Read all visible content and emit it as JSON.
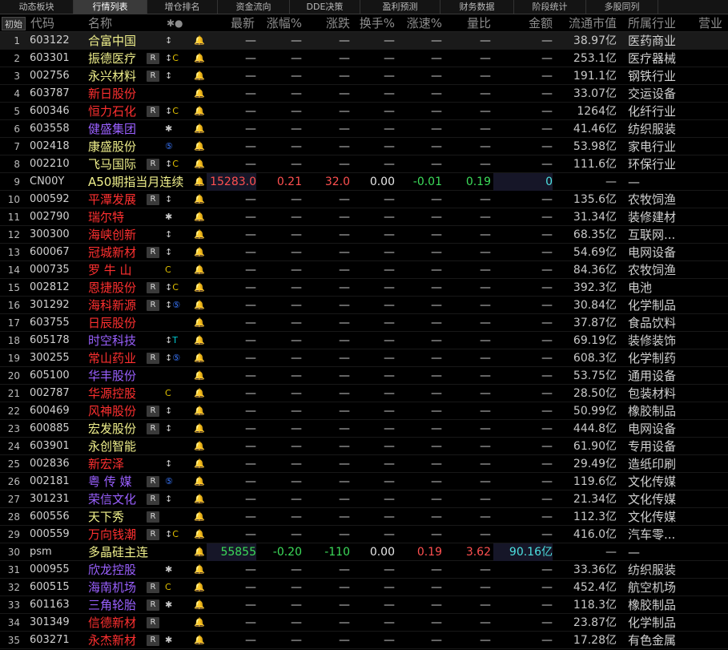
{
  "tabs": [
    {
      "label": "动态板块",
      "active": false
    },
    {
      "label": "行情列表",
      "active": true
    },
    {
      "label": "增仓排名",
      "active": false
    },
    {
      "label": "资金流向",
      "active": false
    },
    {
      "label": "DDE决策",
      "active": false
    },
    {
      "label": "盈利预测",
      "active": false
    },
    {
      "label": "财务数据",
      "active": false
    },
    {
      "label": "阶段统计",
      "active": false
    },
    {
      "label": "多股同列",
      "active": false
    }
  ],
  "header": {
    "reset": "初始",
    "code": "代码",
    "name": "名称",
    "mark": "✱●",
    "latest": "最新",
    "change_pct": "涨幅%",
    "change_amt": "涨跌",
    "turnover": "换手%",
    "speed": "涨速%",
    "volume_ratio": "量比",
    "amount": "金额",
    "float_cap": "流通市值",
    "industry": "所属行业",
    "business": "营业"
  },
  "colors": {
    "red": "#ff3030",
    "yellow": "#f0f08c",
    "purple": "#9a60ff",
    "up": "#ff5050",
    "down": "#3cdc5a"
  },
  "rows": [
    {
      "idx": "1",
      "code": "603122",
      "name": "合富中国",
      "nc": "y",
      "flag": "",
      "mark": [
        [
          "↕",
          ""
        ],
        [
          "",
          ""
        ]
      ],
      "cap": "38.97亿",
      "ind": "医药商业"
    },
    {
      "idx": "2",
      "code": "603301",
      "name": "振德医疗",
      "nc": "y",
      "flag": "R",
      "mark": [
        [
          "↕",
          ""
        ],
        [
          "C",
          "cc"
        ]
      ],
      "cap": "253.1亿",
      "ind": "医疗器械"
    },
    {
      "idx": "3",
      "code": "002756",
      "name": "永兴材料",
      "nc": "y",
      "flag": "R",
      "mark": [
        [
          "↕",
          ""
        ],
        [
          "",
          ""
        ]
      ],
      "cap": "191.1亿",
      "ind": "钢铁行业"
    },
    {
      "idx": "4",
      "code": "603787",
      "name": "新日股份",
      "nc": "r",
      "flag": "",
      "mark": [
        [
          "",
          ""
        ],
        [
          "",
          ""
        ]
      ],
      "cap": "33.07亿",
      "ind": "交运设备"
    },
    {
      "idx": "5",
      "code": "600346",
      "name": "恒力石化",
      "nc": "r",
      "flag": "R",
      "mark": [
        [
          "↕",
          ""
        ],
        [
          "C",
          "cc"
        ]
      ],
      "cap": "1264亿",
      "ind": "化纤行业"
    },
    {
      "idx": "6",
      "code": "603558",
      "name": "健盛集团",
      "nc": "p",
      "flag": "",
      "mark": [
        [
          "✱",
          ""
        ],
        [
          "",
          ""
        ]
      ],
      "cap": "41.46亿",
      "ind": "纺织服装"
    },
    {
      "idx": "7",
      "code": "002418",
      "name": "康盛股份",
      "nc": "y",
      "flag": "",
      "mark": [
        [
          "",
          ""
        ],
        [
          "⑤",
          "cir"
        ]
      ],
      "cap": "53.98亿",
      "ind": "家电行业"
    },
    {
      "idx": "8",
      "code": "002210",
      "name": "飞马国际",
      "nc": "y",
      "flag": "R",
      "mark": [
        [
          "↕",
          ""
        ],
        [
          "C",
          "cc"
        ]
      ],
      "cap": "111.6亿",
      "ind": "环保行业"
    },
    {
      "idx": "9",
      "code": "CN00Y",
      "name": "A50期指当月连续",
      "nc": "y",
      "flag": "",
      "mark": [
        [
          "",
          ""
        ],
        [
          "",
          ""
        ]
      ],
      "special": {
        "new": "15283.0",
        "chg": "0.21",
        "amt": "32.0",
        "turn": "0.00",
        "spd": "-0.01",
        "vr": "0.19",
        "money": "0"
      },
      "cap": "—",
      "ind": "—"
    },
    {
      "idx": "10",
      "code": "000592",
      "name": "平潭发展",
      "nc": "r",
      "flag": "R",
      "mark": [
        [
          "↕",
          ""
        ],
        [
          "",
          ""
        ]
      ],
      "cap": "135.6亿",
      "ind": "农牧饲渔"
    },
    {
      "idx": "11",
      "code": "002790",
      "name": "瑞尔特",
      "nc": "r",
      "flag": "",
      "mark": [
        [
          "✱",
          ""
        ],
        [
          "",
          ""
        ]
      ],
      "cap": "31.34亿",
      "ind": "装修建材"
    },
    {
      "idx": "12",
      "code": "300300",
      "name": "海峡创新",
      "nc": "r",
      "flag": "",
      "mark": [
        [
          "↕",
          ""
        ],
        [
          "",
          ""
        ]
      ],
      "cap": "68.35亿",
      "ind": "互联网..."
    },
    {
      "idx": "13",
      "code": "600067",
      "name": "冠城新材",
      "nc": "r",
      "flag": "R",
      "mark": [
        [
          "↕",
          ""
        ],
        [
          "",
          ""
        ]
      ],
      "cap": "54.69亿",
      "ind": "电网设备"
    },
    {
      "idx": "14",
      "code": "000735",
      "name": "罗 牛 山",
      "nc": "r",
      "flag": "",
      "mark": [
        [
          "",
          ""
        ],
        [
          "C",
          "cc"
        ]
      ],
      "cap": "84.36亿",
      "ind": "农牧饲渔"
    },
    {
      "idx": "15",
      "code": "002812",
      "name": "恩捷股份",
      "nc": "r",
      "flag": "R",
      "mark": [
        [
          "↕",
          ""
        ],
        [
          "C",
          "cc"
        ]
      ],
      "cap": "392.3亿",
      "ind": "电池"
    },
    {
      "idx": "16",
      "code": "301292",
      "name": "海科新源",
      "nc": "r",
      "flag": "R",
      "mark": [
        [
          "↕",
          ""
        ],
        [
          "⑤",
          "cir"
        ]
      ],
      "cap": "30.84亿",
      "ind": "化学制品"
    },
    {
      "idx": "17",
      "code": "603755",
      "name": "日辰股份",
      "nc": "r",
      "flag": "",
      "mark": [
        [
          "",
          ""
        ],
        [
          "",
          ""
        ]
      ],
      "cap": "37.87亿",
      "ind": "食品饮料"
    },
    {
      "idx": "18",
      "code": "605178",
      "name": "时空科技",
      "nc": "p",
      "flag": "",
      "mark": [
        [
          "↕",
          ""
        ],
        [
          "T",
          "tt"
        ]
      ],
      "cap": "69.19亿",
      "ind": "装修装饰"
    },
    {
      "idx": "19",
      "code": "300255",
      "name": "常山药业",
      "nc": "r",
      "flag": "R",
      "mark": [
        [
          "↕",
          ""
        ],
        [
          "⑤",
          "cir"
        ]
      ],
      "cap": "608.3亿",
      "ind": "化学制药"
    },
    {
      "idx": "20",
      "code": "605100",
      "name": "华丰股份",
      "nc": "p",
      "flag": "",
      "mark": [
        [
          "",
          ""
        ],
        [
          "",
          ""
        ]
      ],
      "cap": "53.75亿",
      "ind": "通用设备"
    },
    {
      "idx": "21",
      "code": "002787",
      "name": "华源控股",
      "nc": "r",
      "flag": "",
      "mark": [
        [
          "",
          ""
        ],
        [
          "C",
          "cc"
        ]
      ],
      "cap": "28.50亿",
      "ind": "包装材料"
    },
    {
      "idx": "22",
      "code": "600469",
      "name": "风神股份",
      "nc": "r",
      "flag": "R",
      "mark": [
        [
          "↕",
          ""
        ],
        [
          "",
          ""
        ]
      ],
      "cap": "50.99亿",
      "ind": "橡胶制品"
    },
    {
      "idx": "23",
      "code": "600885",
      "name": "宏发股份",
      "nc": "y",
      "flag": "R",
      "mark": [
        [
          "↕",
          ""
        ],
        [
          "",
          ""
        ]
      ],
      "cap": "444.8亿",
      "ind": "电网设备"
    },
    {
      "idx": "24",
      "code": "603901",
      "name": "永创智能",
      "nc": "y",
      "flag": "",
      "mark": [
        [
          "",
          ""
        ],
        [
          "",
          ""
        ]
      ],
      "cap": "61.90亿",
      "ind": "专用设备"
    },
    {
      "idx": "25",
      "code": "002836",
      "name": "新宏泽",
      "nc": "r",
      "flag": "",
      "mark": [
        [
          "↕",
          ""
        ],
        [
          "",
          ""
        ]
      ],
      "cap": "29.49亿",
      "ind": "造纸印刷"
    },
    {
      "idx": "26",
      "code": "002181",
      "name": "粤 传 媒",
      "nc": "p",
      "flag": "R",
      "mark": [
        [
          "",
          ""
        ],
        [
          "⑤",
          "cir"
        ]
      ],
      "cap": "119.6亿",
      "ind": "文化传媒"
    },
    {
      "idx": "27",
      "code": "301231",
      "name": "荣信文化",
      "nc": "p",
      "flag": "R",
      "mark": [
        [
          "↕",
          ""
        ],
        [
          "",
          ""
        ]
      ],
      "cap": "21.34亿",
      "ind": "文化传媒"
    },
    {
      "idx": "28",
      "code": "600556",
      "name": "天下秀",
      "nc": "y",
      "flag": "R",
      "mark": [
        [
          "",
          ""
        ],
        [
          "",
          ""
        ]
      ],
      "cap": "112.3亿",
      "ind": "文化传媒"
    },
    {
      "idx": "29",
      "code": "000559",
      "name": "万向钱潮",
      "nc": "r",
      "flag": "R",
      "mark": [
        [
          "↕",
          ""
        ],
        [
          "C",
          "cc"
        ]
      ],
      "cap": "416.0亿",
      "ind": "汽车零..."
    },
    {
      "idx": "30",
      "code": "psm",
      "name": "多晶硅主连",
      "nc": "y",
      "flag": "",
      "mark": [
        [
          "",
          ""
        ],
        [
          "",
          ""
        ]
      ],
      "special": {
        "new": "55855",
        "chg": "-0.20",
        "amt": "-110",
        "turn": "0.00",
        "spd": "0.19",
        "vr": "3.62",
        "money": "90.16亿"
      },
      "cap": "—",
      "ind": "—"
    },
    {
      "idx": "31",
      "code": "000955",
      "name": "欣龙控股",
      "nc": "p",
      "flag": "",
      "mark": [
        [
          "✱",
          ""
        ],
        [
          "",
          ""
        ]
      ],
      "cap": "33.36亿",
      "ind": "纺织服装"
    },
    {
      "idx": "32",
      "code": "600515",
      "name": "海南机场",
      "nc": "p",
      "flag": "R",
      "mark": [
        [
          "",
          ""
        ],
        [
          "C",
          "cc"
        ]
      ],
      "cap": "452.4亿",
      "ind": "航空机场"
    },
    {
      "idx": "33",
      "code": "601163",
      "name": "三角轮胎",
      "nc": "p",
      "flag": "R",
      "mark": [
        [
          "✱",
          ""
        ],
        [
          "",
          ""
        ]
      ],
      "cap": "118.3亿",
      "ind": "橡胶制品"
    },
    {
      "idx": "34",
      "code": "301349",
      "name": "信德新材",
      "nc": "r",
      "flag": "R",
      "mark": [
        [
          "",
          ""
        ],
        [
          "",
          ""
        ]
      ],
      "cap": "23.87亿",
      "ind": "化学制品"
    },
    {
      "idx": "35",
      "code": "603271",
      "name": "永杰新材",
      "nc": "r",
      "flag": "R",
      "mark": [
        [
          "✱",
          ""
        ],
        [
          "",
          ""
        ]
      ],
      "cap": "17.28亿",
      "ind": "有色金属"
    }
  ],
  "dash": "—"
}
